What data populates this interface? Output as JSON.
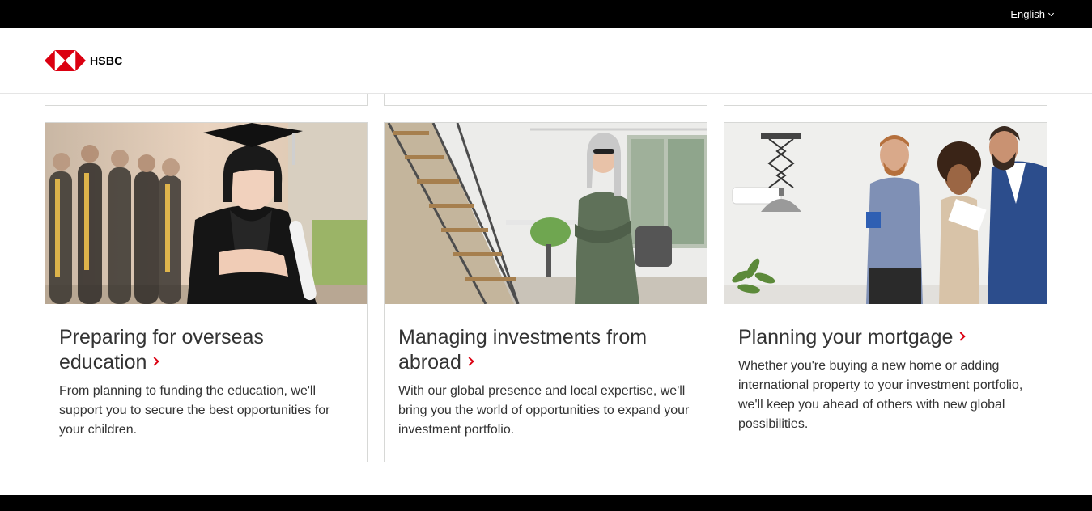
{
  "topbar": {
    "language": "English"
  },
  "header": {
    "logo_text": "HSBC"
  },
  "cards": [
    {
      "title": "Preparing for overseas education",
      "description": "From planning to funding the education, we'll support you to secure the best opportunities for your children.",
      "image": "graduate-photo"
    },
    {
      "title": "Managing investments from abroad",
      "description": "With our global presence and local expertise, we'll bring you the world of opportunities to expand your investment portfolio.",
      "image": "office-woman-photo"
    },
    {
      "title": "Planning your mortgage",
      "description": "Whether you're buying a new home or adding international property to your investment portfolio, we'll keep you ahead of others with new global possibilities.",
      "image": "couple-with-advisor-photo"
    }
  ],
  "colors": {
    "brand_red": "#db0011",
    "topbar": "#000000",
    "border": "#d7d8d6"
  }
}
